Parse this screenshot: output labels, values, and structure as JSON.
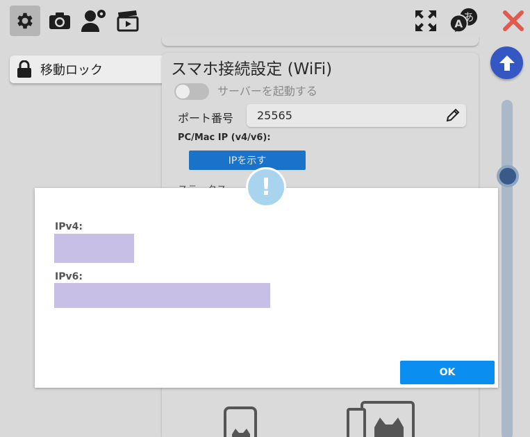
{
  "toolbar": {
    "left_icons": [
      "gear-icon",
      "camera-icon",
      "user-settings-icon",
      "clapperboard-icon"
    ],
    "right_icons": [
      "fullscreen-icon",
      "translate-icon",
      "close-icon"
    ],
    "close_color": "#e05a4e"
  },
  "sidebar": {
    "items": [
      {
        "label": "移動ロック",
        "icon": "lock-icon"
      }
    ]
  },
  "panel": {
    "title": "スマホ接続設定 (WiFi)",
    "server_toggle_label": "サーバーを起動する",
    "server_toggle_on": false,
    "port_label": "ポート番号",
    "port_value": "25565",
    "ip_label": "PC/Mac IP (v4/v6):",
    "show_ip_button": "IPを示す",
    "status_partial": "ステータス"
  },
  "dialog": {
    "ipv4_label": "IPv4:",
    "ipv6_label": "IPv6:",
    "ok_label": "OK",
    "redaction_color": "#c8bfe7",
    "accent": "#0a8ff0"
  }
}
